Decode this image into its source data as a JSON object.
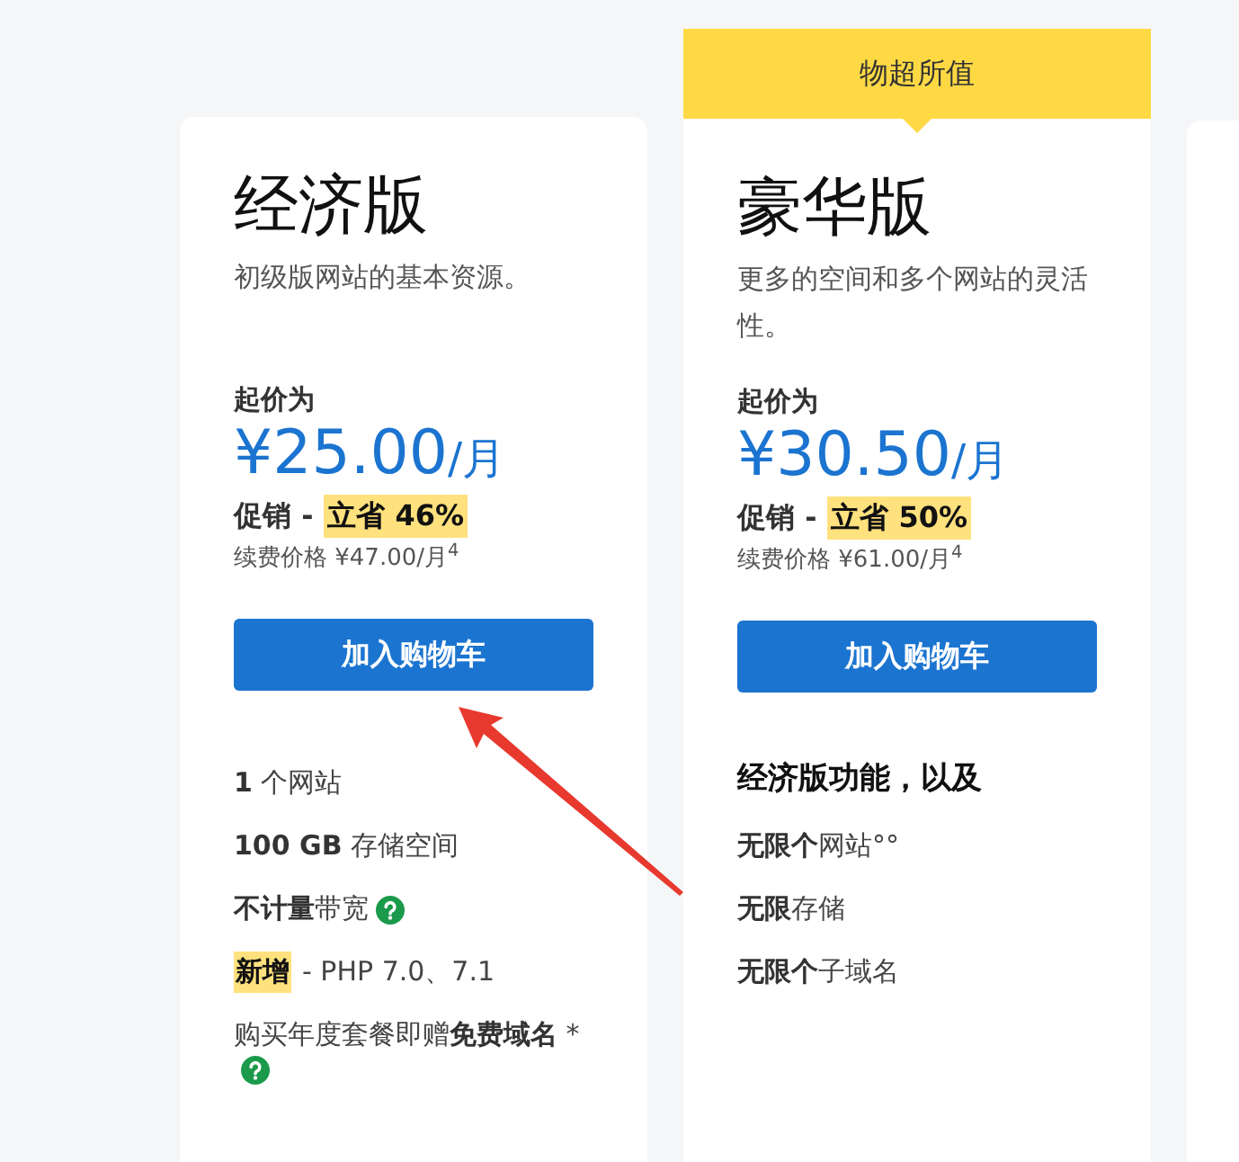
{
  "plans": [
    {
      "title": "经济版",
      "description": "初级版网站的基本资源。",
      "price_label": "起价为",
      "price": "¥25.00",
      "price_unit": "/月",
      "promo_label": "促销 -",
      "promo_badge": "立省 46%",
      "renewal": "续费价格 ¥47.00/月$^{4}$",
      "button": "加入购物车",
      "features": [
        {
          "text": "**1** 个网站",
          "help": false
        },
        {
          "text": "**100 GB** 存储空间",
          "help": false
        },
        {
          "text": "**不计量**带宽",
          "help": true
        },
        {
          "tag": "新增",
          "text": "- PHP 7.0、7.1",
          "help": false
        },
        {
          "text": "购买年度套餐即赠**免费域名** *",
          "help": true
        }
      ]
    },
    {
      "ribbon": "物超所值",
      "title": "豪华版",
      "description": "更多的空间和多个网站的灵活性。",
      "price_label": "起价为",
      "price": "¥30.50",
      "price_unit": "/月",
      "promo_label": "促销 -",
      "promo_badge": "立省 50%",
      "renewal": "续费价格 ¥61.00/月$^{4}$",
      "button": "加入购物车",
      "features_heading": "经济版功能，以及",
      "features": [
        {
          "text": "**无限个**网站°°",
          "help": false
        },
        {
          "text": "**无限**存储",
          "help": false
        },
        {
          "text": "**无限个**子域名",
          "help": false
        }
      ]
    }
  ]
}
